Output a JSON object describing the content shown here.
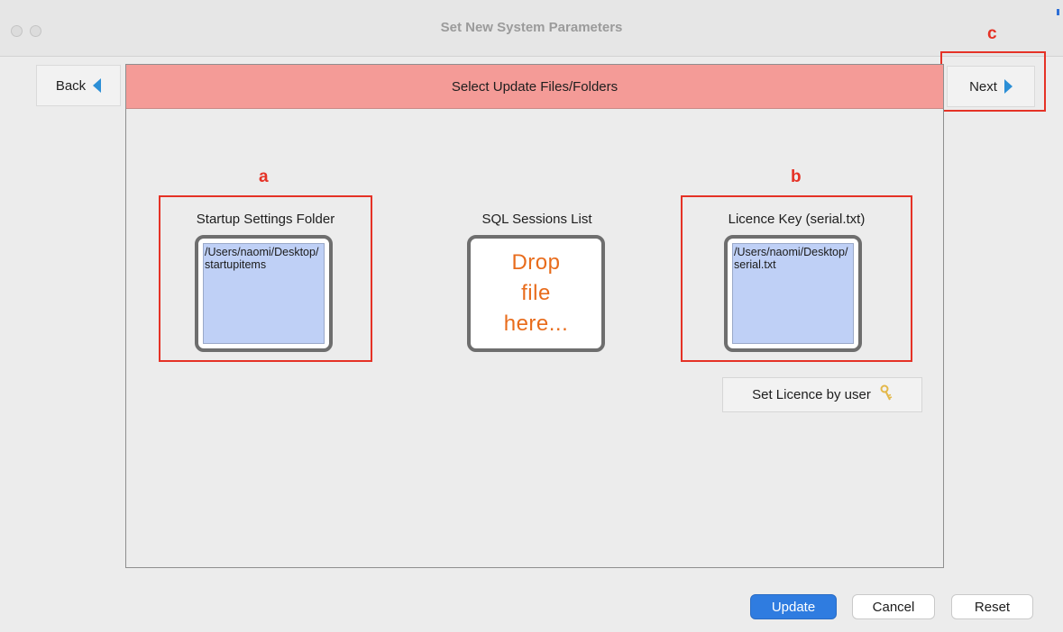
{
  "window": {
    "title": "Set New System Parameters"
  },
  "nav": {
    "back_label": "Back",
    "next_label": "Next"
  },
  "panel": {
    "header": "Select Update Files/Folders"
  },
  "annotations": {
    "a": "a",
    "b": "b",
    "c": "c"
  },
  "groups": {
    "startup": {
      "label": "Startup Settings Folder",
      "value": "/Users/naomi/Desktop/startupitems"
    },
    "sql": {
      "label": "SQL Sessions List",
      "placeholder": "Drop\nfile\nhere..."
    },
    "licence": {
      "label": "Licence Key (serial.txt)",
      "value": "/Users/naomi/Desktop/serial.txt"
    }
  },
  "set_licence_button": {
    "label": "Set Licence by user",
    "icon": "key-icon"
  },
  "footer": {
    "update_label": "Update",
    "cancel_label": "Cancel",
    "reset_label": "Reset"
  },
  "colors": {
    "header_bg": "#f49b97",
    "annotation_red": "#e53226",
    "drop_fill": "#bfd0f6",
    "drop_text": "#e86c1c",
    "primary_button": "#2f7ce0"
  }
}
